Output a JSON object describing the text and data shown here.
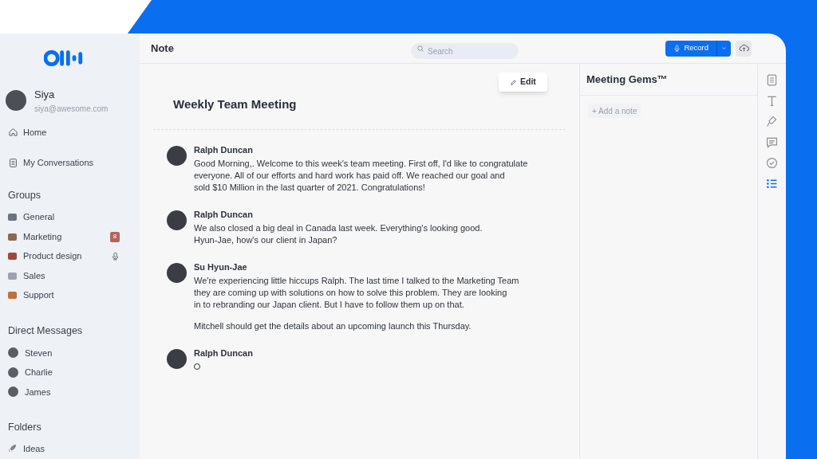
{
  "sidebar": {
    "user": {
      "name": "Siya",
      "email": "siya@awesome.com"
    },
    "nav": [
      {
        "label": "Home",
        "kind": "home"
      },
      {
        "label": "My Conversations",
        "kind": "document"
      }
    ],
    "groups": {
      "title": "Groups",
      "items": [
        {
          "label": "General",
          "color": "#6b7280"
        },
        {
          "label": "Marketing",
          "color": "#8b6b4a",
          "badge": "8"
        },
        {
          "label": "Product design",
          "color": "#9b4a3c",
          "recording": true
        },
        {
          "label": "Sales",
          "color": "#9ca3af"
        },
        {
          "label": "Support",
          "color": "#c2703a"
        }
      ]
    },
    "direct_messages": {
      "title": "Direct Messages",
      "items": [
        "Steven",
        "Charlie",
        "James"
      ]
    },
    "folders": {
      "title": "Folders",
      "items": [
        "Ideas"
      ]
    }
  },
  "header": {
    "title": "Note",
    "search": {
      "placeholder": "Search"
    },
    "record_button": "Record"
  },
  "note": {
    "edit_button": "Edit",
    "title": "Weekly Team Meeting",
    "messages": [
      {
        "speaker": "Ralph Duncan",
        "paragraphs": [
          [
            "Good Morning,. Welcome to this week's team meeting. First off, I'd like to congratulate",
            "everyone. All of our efforts and hard work has paid off. We reached our goal and",
            "sold $10 Million in the last quarter of 2021. Congratulations!"
          ]
        ]
      },
      {
        "speaker": "Ralph Duncan",
        "paragraphs": [
          [
            "We also closed a big deal in Canada last week. Everything's looking good.",
            "Hyun-Jae, how's our client in Japan?"
          ]
        ]
      },
      {
        "speaker": "Su Hyun-Jae",
        "paragraphs": [
          [
            "We're experiencing little hiccups Ralph. The last time I talked to the Marketing Team",
            "they are coming up with solutions on how to solve this problem. They are looking",
            "in to rebranding our Japan client. But I have to follow them up on that."
          ],
          [
            "Mitchell should get the details about an upcoming launch this Thursday."
          ]
        ]
      },
      {
        "speaker": "Ralph Duncan",
        "typing": true
      }
    ]
  },
  "gems": {
    "title": "Meeting Gems™",
    "add_note": "+ Add a note"
  },
  "rail": [
    {
      "kind": "document",
      "selected": false
    },
    {
      "kind": "text",
      "selected": false
    },
    {
      "kind": "highlighter",
      "selected": false
    },
    {
      "kind": "comment",
      "selected": false
    },
    {
      "kind": "check",
      "selected": false
    },
    {
      "kind": "list",
      "selected": true
    }
  ]
}
